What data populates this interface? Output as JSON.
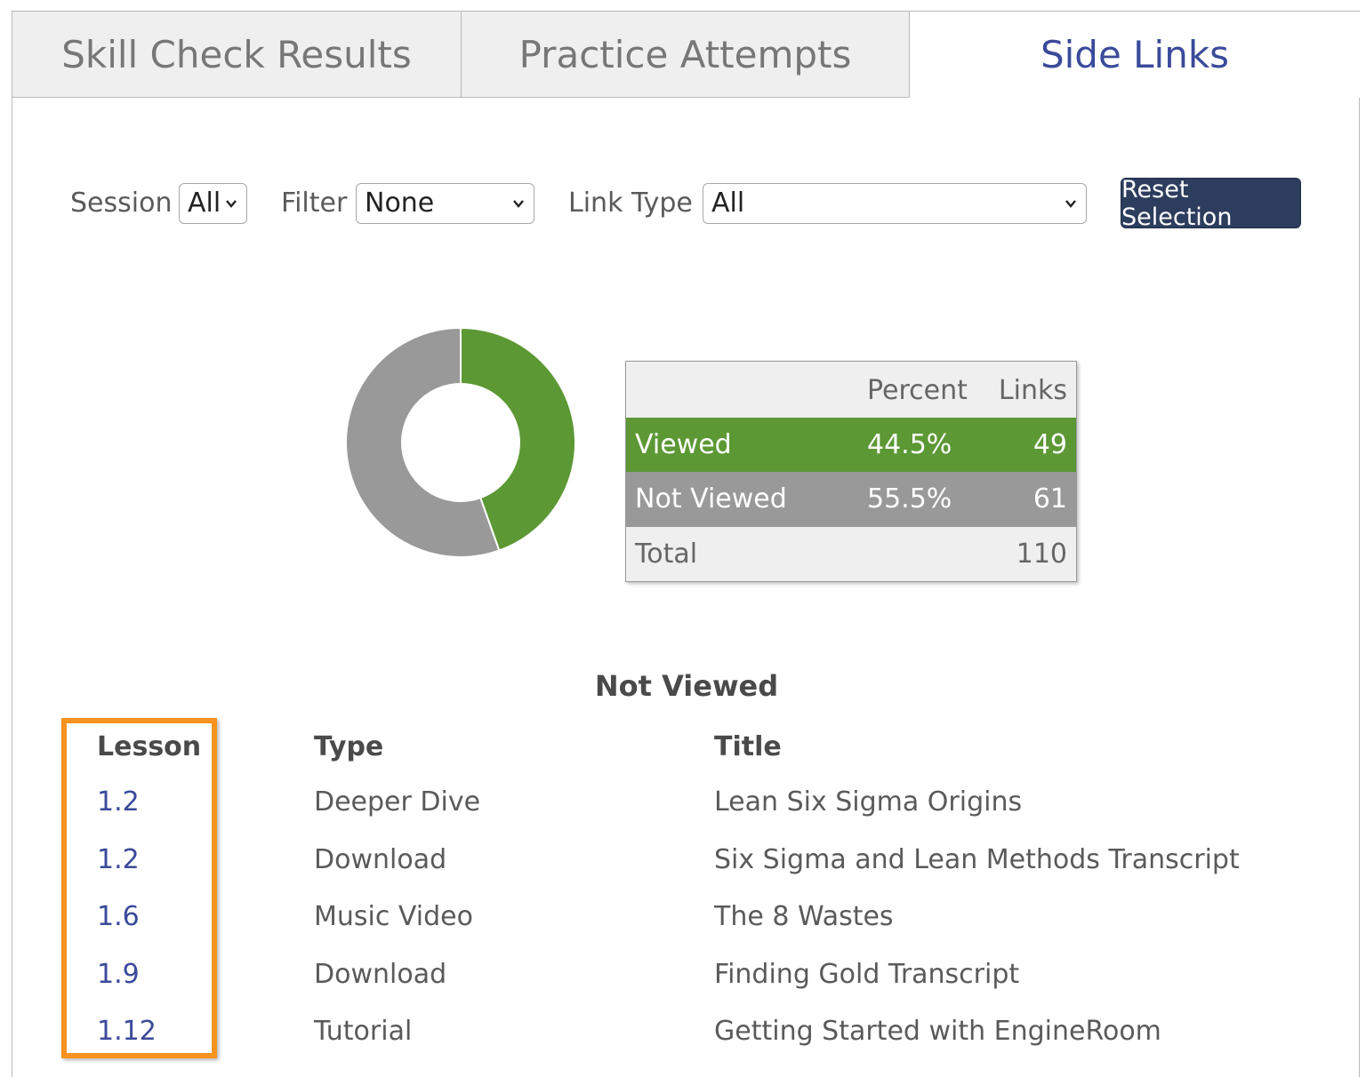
{
  "tabs": [
    {
      "label": "Skill Check Results",
      "active": false
    },
    {
      "label": "Practice Attempts",
      "active": false
    },
    {
      "label": "Side Links",
      "active": true
    }
  ],
  "controls": {
    "session_label": "Session",
    "session_value": "All",
    "filter_label": "Filter",
    "filter_value": "None",
    "link_type_label": "Link Type",
    "link_type_value": "All",
    "reset_label": "Reset Selection"
  },
  "colors": {
    "viewed": "#5c9834",
    "not_viewed": "#999999",
    "accent": "#3a4a9a",
    "button": "#2d3d5e",
    "highlight": "#f7931e"
  },
  "chart_data": {
    "type": "pie",
    "donut": true,
    "categories": [
      "Viewed",
      "Not Viewed"
    ],
    "values": [
      49,
      61
    ],
    "percents": [
      44.5,
      55.5
    ]
  },
  "summary": {
    "headers": {
      "percent": "Percent",
      "links": "Links"
    },
    "rows": [
      {
        "label": "Viewed",
        "percent": "44.5%",
        "links": "49"
      },
      {
        "label": "Not Viewed",
        "percent": "55.5%",
        "links": "61"
      }
    ],
    "total": {
      "label": "Total",
      "links": "110"
    }
  },
  "section_title": "Not Viewed",
  "table": {
    "headers": {
      "lesson": "Lesson",
      "type": "Type",
      "title": "Title"
    },
    "rows": [
      {
        "lesson": "1.2",
        "type": "Deeper Dive",
        "title": "Lean Six Sigma Origins"
      },
      {
        "lesson": "1.2",
        "type": "Download",
        "title": "Six Sigma and Lean Methods Transcript"
      },
      {
        "lesson": "1.6",
        "type": "Music Video",
        "title": "The 8 Wastes"
      },
      {
        "lesson": "1.9",
        "type": "Download",
        "title": "Finding Gold Transcript"
      },
      {
        "lesson": "1.12",
        "type": "Tutorial",
        "title": "Getting Started with EngineRoom"
      }
    ]
  }
}
